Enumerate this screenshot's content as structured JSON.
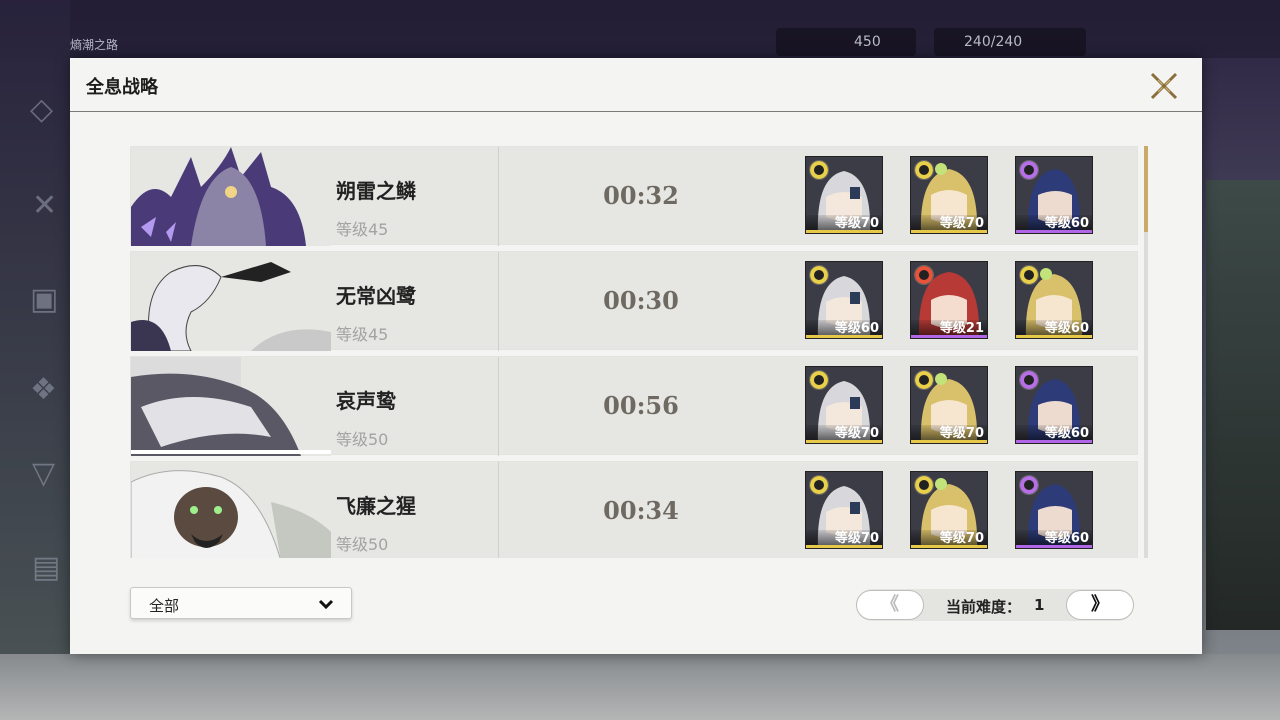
{
  "background": {
    "top_left_text": "熵潮之路",
    "currency_value": "450",
    "energy_value": "240/240"
  },
  "modal": {
    "title": "全息战略"
  },
  "bosses": [
    {
      "name": "朔雷之鳞",
      "level": "等级45",
      "clear_time": "00:32",
      "art_icon": "void-thunder-boss-portrait",
      "team": [
        {
          "element": "spectro",
          "level": "等级70",
          "rarity_color": "#e6c948"
        },
        {
          "element": "spectro",
          "level": "等级70",
          "rarity_color": "#e6c948"
        },
        {
          "element": "havoc",
          "level": "等级60",
          "rarity_color": "#b066e6"
        }
      ]
    },
    {
      "name": "无常凶鹭",
      "level": "等级45",
      "clear_time": "00:30",
      "art_icon": "heron-boss-portrait",
      "team": [
        {
          "element": "spectro",
          "level": "等级60",
          "rarity_color": "#e6c948"
        },
        {
          "element": "fusion",
          "level": "等级21",
          "rarity_color": "#b066e6"
        },
        {
          "element": "spectro",
          "level": "等级60",
          "rarity_color": "#e6c948"
        }
      ]
    },
    {
      "name": "哀声鸷",
      "level": "等级50",
      "clear_time": "00:56",
      "art_icon": "mourning-aix-boss-portrait",
      "team": [
        {
          "element": "spectro",
          "level": "等级70",
          "rarity_color": "#e6c948"
        },
        {
          "element": "spectro",
          "level": "等级70",
          "rarity_color": "#e6c948"
        },
        {
          "element": "havoc",
          "level": "等级60",
          "rarity_color": "#b066e6"
        }
      ]
    },
    {
      "name": "飞廉之猩",
      "level": "等级50",
      "clear_time": "00:34",
      "art_icon": "feilian-beringal-boss-portrait",
      "team": [
        {
          "element": "spectro",
          "level": "等级70",
          "rarity_color": "#e6c948"
        },
        {
          "element": "spectro",
          "level": "等级70",
          "rarity_color": "#e6c948"
        },
        {
          "element": "havoc",
          "level": "等级60",
          "rarity_color": "#b066e6"
        }
      ]
    }
  ],
  "filter": {
    "selected": "全部"
  },
  "pager": {
    "prev_label": "《",
    "label": "当前难度：",
    "value": "1",
    "next_label": "》"
  }
}
